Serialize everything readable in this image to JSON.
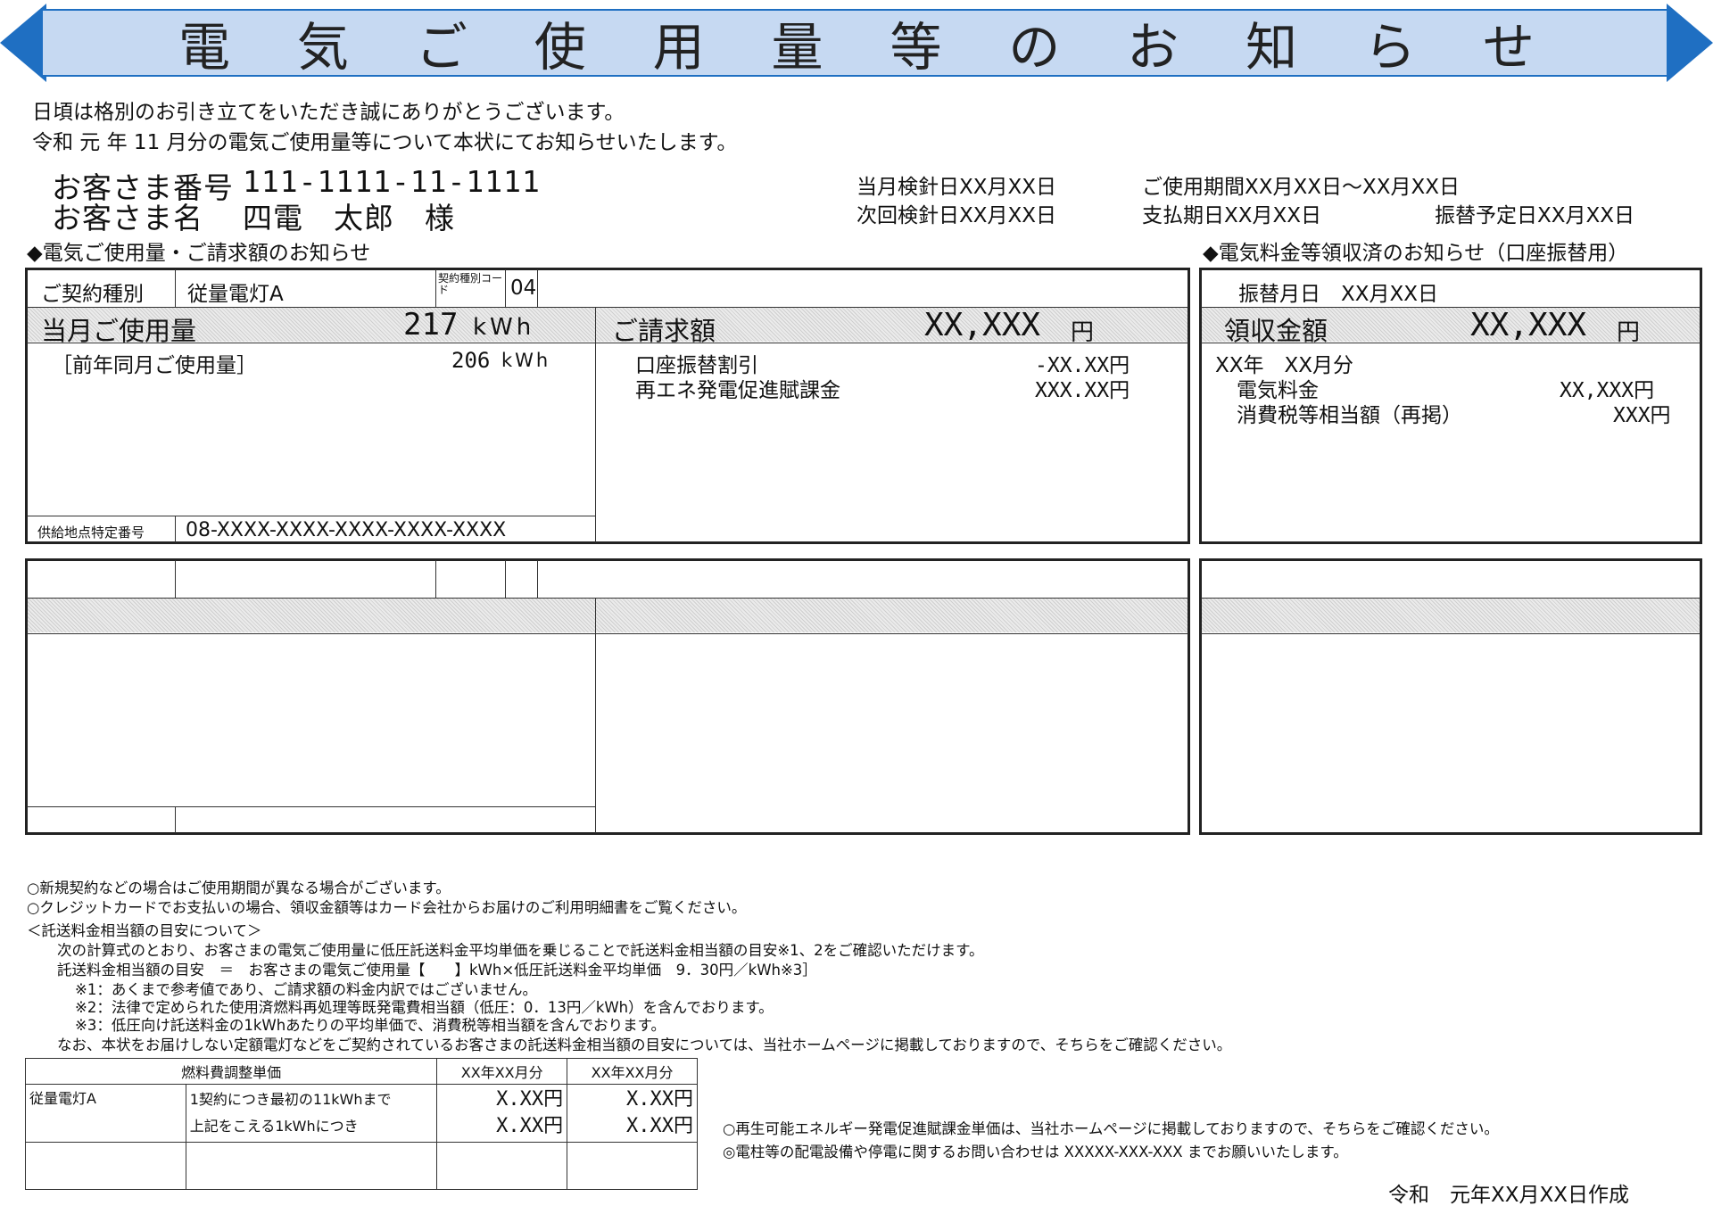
{
  "banner": {
    "title_chars": [
      "電",
      "気",
      "ご",
      "使",
      "用",
      "量",
      "等",
      "の",
      "お",
      "知",
      "ら",
      "せ"
    ]
  },
  "intro": {
    "line1": "日頃は格別のお引き立てをいただき誠にありがとうございます。",
    "line2": "令和 元 年 11 月分の電気ご使用量等について本状にてお知らせいたします。"
  },
  "customer": {
    "number_label": "お客さま番号",
    "number_value": "111-1111-11-1111",
    "name_label": "お客さま名",
    "name_value": "四電　太郎　様"
  },
  "dates": {
    "meter_read": "当月検針日XX月XX日",
    "usage_period": "ご使用期間XX月XX日～XX月XX日",
    "next_read": "次回検針日XX月XX日",
    "payment_due": "支払期日XX月XX日",
    "transfer_date": "振替予定日XX月XX日"
  },
  "sections": {
    "usage_heading": "◆電気ご使用量・ご請求額のお知らせ",
    "receipt_heading": "◆電気料金等領収済のお知らせ（口座振替用）"
  },
  "usage": {
    "contract_label": "ご契約種別",
    "contract_value": "従量電灯A",
    "contract_code_label": "契約種別コード",
    "contract_code_value": "04",
    "current_label": "当月ご使用量",
    "current_value": "217",
    "current_unit": "kWh",
    "prev_label": "［前年同月ご使用量］",
    "prev_value": "206",
    "prev_unit": "kWh",
    "supply_point_label": "供給地点特定番号",
    "supply_point_value": "08-XXXX-XXXX-XXXX-XXXX-XXXX"
  },
  "billing": {
    "label": "ご請求額",
    "amount": "XX,XXX",
    "yen": "円",
    "items": [
      {
        "label": "口座振替割引",
        "value": "-XX.XX円"
      },
      {
        "label": "再エネ発電促進賦課金",
        "value": "XXX.XX円"
      }
    ]
  },
  "receipt": {
    "transfer_month": "振替月日　XX月XX日",
    "label": "領収金額",
    "amount": "XX,XXX",
    "yen": "円",
    "period": "XX年　XX月分",
    "items": [
      {
        "label": "電気料金",
        "value": "XX,XXX円"
      },
      {
        "label": "消費税等相当額（再掲）",
        "value": "XXX円"
      }
    ]
  },
  "notes": [
    "○新規契約などの場合はご使用期間が異なる場合がございます。",
    "○クレジットカードでお支払いの場合、領収金額等はカード会社からお届けのご利用明細書をご覧ください。",
    "＜託送料金相当額の目安について＞",
    "次の計算式のとおり、お客さまの電気ご使用量に低圧託送料金平均単価を乗じることで託送料金相当額の目安※1、2をご確認いただけます。",
    "託送料金相当額の目安　＝　お客さまの電気ご使用量【　　】kWh×低圧託送料金平均単価　9．30円／kWh※3］",
    "※1：あくまで参考値であり、ご請求額の料金内訳ではございません。",
    "※2：法律で定められた使用済燃料再処理等既発電費相当額（低圧：0．13円／kWh）を含んでおります。",
    "※3：低圧向け託送料金の1kWhあたりの平均単価で、消費税等相当額を含んでおります。",
    "なお、本状をお届けしない定額電灯などをご契約されているお客さまの託送料金相当額の目安については、当社ホームページに掲載しておりますので、そちらをご確認ください。"
  ],
  "fuel_table": {
    "header": "燃料費調整単価",
    "col1": "XX年XX月分",
    "col2": "XX年XX月分",
    "plan": "従量電灯A",
    "row1_desc": "1契約につき最初の11kWhまで",
    "row2_desc": "上記をこえる1kWhにつき",
    "row1_v1": "X.XX円",
    "row1_v2": "X.XX円",
    "row2_v1": "X.XX円",
    "row2_v2": "X.XX円"
  },
  "footer": {
    "renewable_note": "○再生可能エネルギー発電促進賦課金単価は、当社ホームページに掲載しておりますので、そちらをご確認ください。",
    "contact_note": "◎電柱等の配電設備や停電に関するお問い合わせは XXXXX-XXX-XXX までお願いいたします。",
    "created": "令和　元年XX月XX日作成"
  },
  "colors": {
    "banner_fill": "#c6d9f2",
    "banner_accent": "#1f6fc2"
  }
}
